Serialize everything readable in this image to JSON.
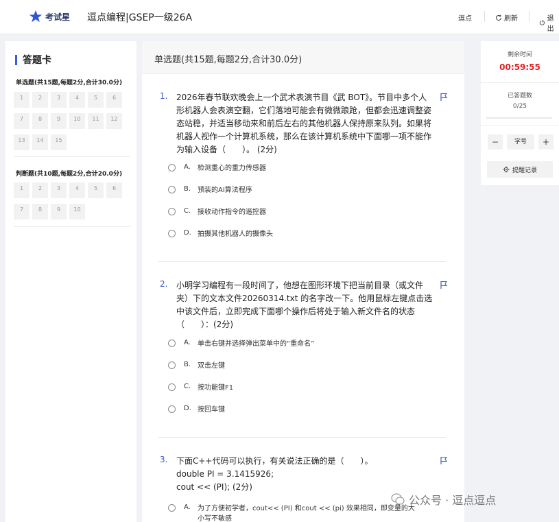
{
  "topbar": {
    "logo_text": "考试星",
    "title": "逗点编程|GSEP一级26A",
    "actions": {
      "home": "逗点",
      "refresh": "刷新",
      "exit": "退出"
    }
  },
  "answer_card": {
    "title": "答题卡",
    "single_section": "单选题(共15题,每题2分,合计30.0分)",
    "single_items": [
      "1",
      "2",
      "3",
      "4",
      "5",
      "6",
      "7",
      "8",
      "9",
      "10",
      "11",
      "12",
      "13",
      "14",
      "15"
    ],
    "judge_section": "判断题(共10题,每题2分,合计20.0分)",
    "judge_items": [
      "1",
      "2",
      "3",
      "4",
      "5",
      "6",
      "7",
      "8",
      "9",
      "10"
    ]
  },
  "main": {
    "section_header": "单选题(共15题,每题2分,合计30.0分)",
    "questions": [
      {
        "num": "1.",
        "text": "2026年春节联欢晚会上一个武术表演节目《武 BOT》。节目中多个人形机器人会表演空翻，它们落地可能会有微微踉跄，但都会迅速调整姿态站稳，并适当移动来和前后左右的其他机器人保持原来队列。如果将机器人视作一个计算机系统，那么在该计算机系统中下面哪一项不能作为输入设备（　　）。 (2分)",
        "options": [
          {
            "letter": "A.",
            "text": "检测重心的重力传感器"
          },
          {
            "letter": "B.",
            "text": "预装的AI算法程序"
          },
          {
            "letter": "C.",
            "text": "接收动作指令的遥控器"
          },
          {
            "letter": "D.",
            "text": "拍摄其他机器人的摄像头"
          }
        ]
      },
      {
        "num": "2.",
        "text": "小明学习编程有一段时间了，他想在图形环境下把当前目录（或文件夹）下的文本文件20260314.txt 的名字改一下。他用鼠标左键点击选中该文件后，立即完成下面哪个操作后将处于输入新文件名的状态（　　）：(2分)",
        "options": [
          {
            "letter": "A.",
            "text": "单击右键并选择弹出菜单中的“重命名”"
          },
          {
            "letter": "B.",
            "text": "双击左键"
          },
          {
            "letter": "C.",
            "text": "按功能键F1"
          },
          {
            "letter": "D.",
            "text": "按回车键"
          }
        ]
      },
      {
        "num": "3.",
        "text_lines": [
          "下面C++代码可以执行，有关说法正确的是（　　）。",
          "double PI = 3.1415926;",
          "cout << (PI); (2分)"
        ],
        "options": [
          {
            "letter": "A.",
            "text": "为了方便初学者，cout<< (PI) 和cout << (pi) 效果相同，即变量的大小写不敏感"
          }
        ]
      }
    ]
  },
  "sidebar": {
    "time_label": "剩余时间",
    "time_value": "00:59:55",
    "answered_label": "已答题数",
    "answered_value": "0/25",
    "answered_fraction": 0,
    "font_minus": "−",
    "font_label": "字号",
    "font_plus": "+",
    "remind_label": "提醒记录"
  },
  "watermark": "公众号 · 逗点逗点"
}
